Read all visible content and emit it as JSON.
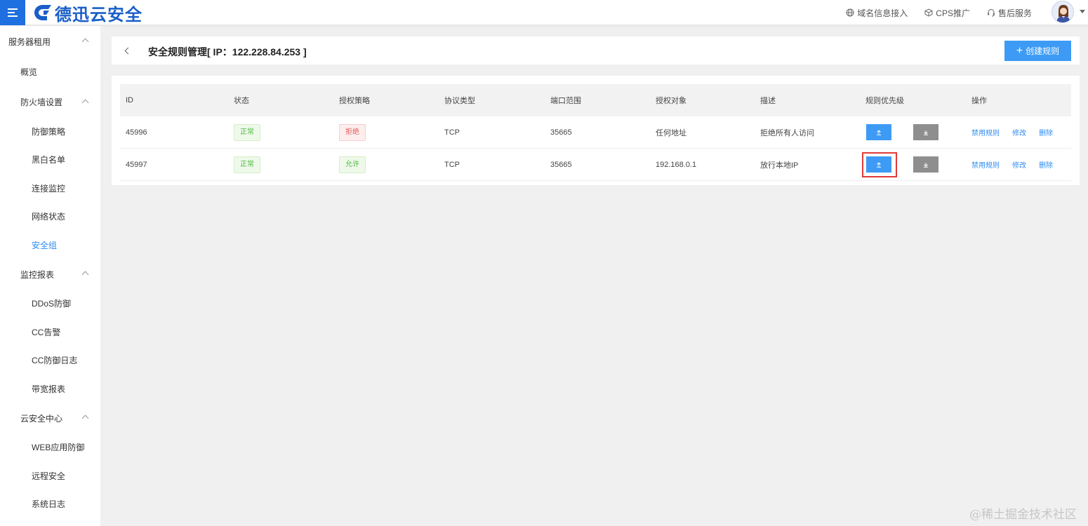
{
  "brand": {
    "name": "德迅云安全",
    "color": "#1a5fc8"
  },
  "header_links": [
    {
      "label": "域名信息接入",
      "icon": "globe-icon"
    },
    {
      "label": "CPS推广",
      "icon": "cube-icon"
    },
    {
      "label": "售后服务",
      "icon": "headset-icon"
    }
  ],
  "sidebar": {
    "items": [
      {
        "label": "服务器租用",
        "level": "group",
        "expanded": true
      },
      {
        "label": "概览",
        "level": "sub"
      },
      {
        "label": "防火墙设置",
        "level": "sub",
        "expanded": true
      },
      {
        "label": "防御策略",
        "level": "leaf"
      },
      {
        "label": "黑白名单",
        "level": "leaf"
      },
      {
        "label": "连接监控",
        "level": "leaf"
      },
      {
        "label": "网络状态",
        "level": "leaf"
      },
      {
        "label": "安全组",
        "level": "leaf",
        "active": true
      },
      {
        "label": "监控报表",
        "level": "sub",
        "expanded": true
      },
      {
        "label": "DDoS防御",
        "level": "leaf"
      },
      {
        "label": "CC告警",
        "level": "leaf"
      },
      {
        "label": "CC防御日志",
        "level": "leaf"
      },
      {
        "label": "带宽报表",
        "level": "leaf"
      },
      {
        "label": "云安全中心",
        "level": "sub",
        "expanded": true
      },
      {
        "label": "WEB应用防御",
        "level": "leaf"
      },
      {
        "label": "远程安全",
        "level": "leaf"
      },
      {
        "label": "系统日志",
        "level": "leaf"
      }
    ]
  },
  "page": {
    "title": "安全规则管理[ IP：122.228.84.253 ]",
    "create_button": "创建规则"
  },
  "table": {
    "headers": [
      "ID",
      "状态",
      "授权策略",
      "协议类型",
      "端口范围",
      "授权对象",
      "描述",
      "规则优先级",
      "操作"
    ],
    "rows": [
      {
        "id": "45996",
        "status": "正常",
        "policy": "拒绝",
        "policy_type": "deny",
        "protocol": "TCP",
        "port": "35665",
        "target": "任何地址",
        "desc": "拒绝所有人访问"
      },
      {
        "id": "45997",
        "status": "正常",
        "policy": "允许",
        "policy_type": "allow",
        "protocol": "TCP",
        "port": "35665",
        "target": "192.168.0.1",
        "desc": "放行本地IP",
        "highlighted": true
      }
    ],
    "actions": [
      "禁用规则",
      "修改",
      "删除"
    ]
  },
  "watermark": "@稀土掘金技术社区",
  "colors": {
    "primary": "#3d9bf5",
    "active": "#2d8cf0",
    "highlight_border": "#e03a3a"
  }
}
